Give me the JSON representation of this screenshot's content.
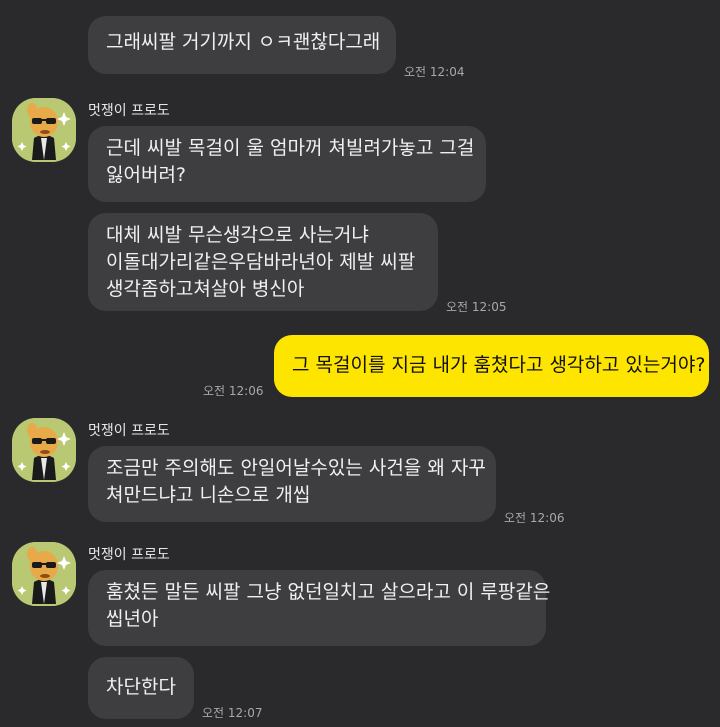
{
  "colors": {
    "background": "#2a2a2c",
    "other_bubble": "#3e3e40",
    "my_bubble": "#fee500",
    "avatar_bg": "#b9c873"
  },
  "sender_name": "멋쟁이 프로도",
  "messages": [
    {
      "from": "other",
      "lines": [
        "그래씨팔 거기까지 ㅇㅋ괜찮다그래"
      ],
      "time": "오전 12:04"
    },
    {
      "from": "other",
      "lines": [
        "근데 씨발 목걸이 울 엄마꺼 쳐빌려가놓고 그걸",
        "잃어버려?"
      ]
    },
    {
      "from": "other",
      "lines": [
        "대체 씨발 무슨생각으로 사는거냐",
        "이돌대가리같은우담바라년아 제발 씨팔",
        "생각좀하고쳐살아 병신아"
      ],
      "time": "오전 12:05"
    },
    {
      "from": "me",
      "lines": [
        "그 목걸이를 지금 내가 훔쳤다고 생각하고 있는거야?"
      ],
      "time": "오전 12:06"
    },
    {
      "from": "other",
      "lines": [
        "조금만 주의해도 안일어날수있는 사건을 왜 자꾸",
        "쳐만드냐고 니손으로 개씹"
      ],
      "time": "오전 12:06"
    },
    {
      "from": "other",
      "lines": [
        "훔쳤든 말든 씨팔 그냥 없던일치고 살으라고 이 루팡같은",
        "씹년아"
      ]
    },
    {
      "from": "other",
      "lines": [
        "차단한다"
      ],
      "time": "오전 12:07"
    }
  ],
  "avatar_icon": "frodo-character-icon"
}
